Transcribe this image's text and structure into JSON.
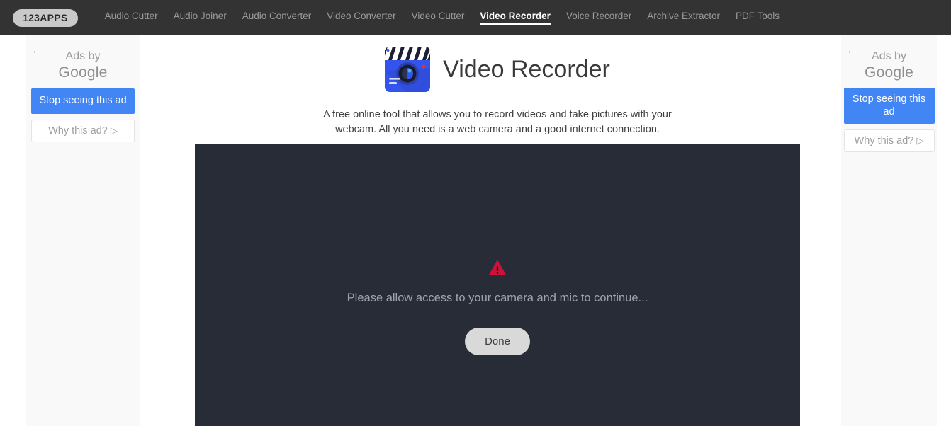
{
  "navbar": {
    "brand": "123APPS",
    "links": [
      {
        "label": "Audio Cutter",
        "active": false
      },
      {
        "label": "Audio Joiner",
        "active": false
      },
      {
        "label": "Audio Converter",
        "active": false
      },
      {
        "label": "Video Converter",
        "active": false
      },
      {
        "label": "Video Cutter",
        "active": false
      },
      {
        "label": "Video Recorder",
        "active": true
      },
      {
        "label": "Voice Recorder",
        "active": false
      },
      {
        "label": "Archive Extractor",
        "active": false
      },
      {
        "label": "PDF Tools",
        "active": false
      }
    ]
  },
  "header": {
    "icon_name": "video-recorder-app-icon",
    "title": "Video Recorder",
    "description": "A free online tool that allows you to record videos and take pictures with your webcam. All you need is a web camera and a good internet connection."
  },
  "video_stage": {
    "warning_icon_name": "warning-triangle-icon",
    "message": "Please allow access to your camera and mic to continue...",
    "done_label": "Done"
  },
  "ads": {
    "left": {
      "back_arrow": "←",
      "ads_by": "Ads by",
      "google": "Google",
      "stop_label": "Stop seeing this ad",
      "why_label": "Why this ad?",
      "why_caret": "▷"
    },
    "right": {
      "back_arrow": "←",
      "ads_by": "Ads by",
      "google": "Google",
      "stop_label": "Stop seeing this ad",
      "why_label": "Why this ad?",
      "why_caret": "▷"
    }
  },
  "colors": {
    "navbar_bg": "#333333",
    "stage_bg": "#282c36",
    "ad_blue": "#4285f4",
    "warning_red": "#d0103a",
    "ad_panel_bg": "#f9f9f9",
    "icon_blue": "#3b5bdb"
  }
}
